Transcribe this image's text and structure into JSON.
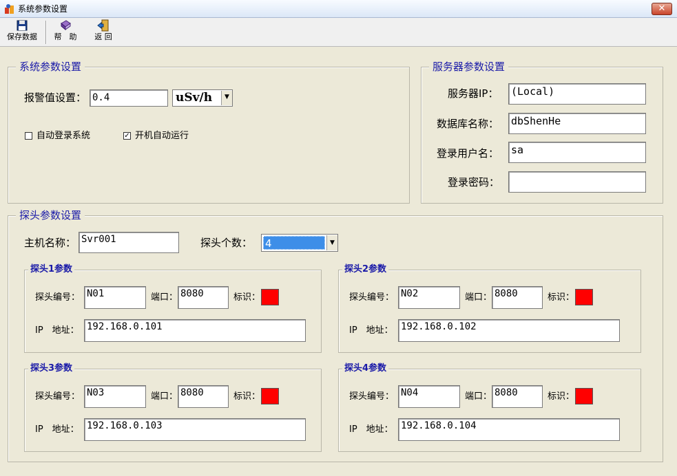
{
  "window": {
    "title": "系统参数设置",
    "close_symbol": "✕"
  },
  "toolbar": {
    "save_label": "保存数据",
    "help_label": "帮　助",
    "back_label": "返 回"
  },
  "system_group": {
    "legend": "系统参数设置",
    "alarm_label": "报警值设置：",
    "alarm_value": "0.4",
    "unit_selected": "uSv/h",
    "auto_login": {
      "label": "自动登录系统",
      "checked": ""
    },
    "auto_start": {
      "label": "开机自动运行",
      "checked": "✓"
    }
  },
  "server_group": {
    "legend": "服务器参数设置",
    "server_ip_label": "服务器IP：",
    "server_ip_value": "(Local)",
    "db_name_label": "数据库名称：",
    "db_name_value": "dbShenHe",
    "user_label": "登录用户名：",
    "user_value": "sa",
    "password_label": "登录密码：",
    "password_value": ""
  },
  "probe_group": {
    "legend": "探头参数设置",
    "host_label": "主机名称：",
    "host_value": "Svr001",
    "count_label": "探头个数：",
    "count_value": "4",
    "probes": [
      {
        "legend": "探头1参数",
        "id_label": "探头编号：",
        "id_value": "N01",
        "port_label": "端口：",
        "port_value": "8080",
        "mark_label": "标识：",
        "mark_color": "#ff0000",
        "ip_label": "IP　地址：",
        "ip_value": "192.168.0.101"
      },
      {
        "legend": "探头2参数",
        "id_label": "探头编号：",
        "id_value": "N02",
        "port_label": "端口：",
        "port_value": "8080",
        "mark_label": "标识：",
        "mark_color": "#ff0000",
        "ip_label": "IP　地址：",
        "ip_value": "192.168.0.102"
      },
      {
        "legend": "探头3参数",
        "id_label": "探头编号：",
        "id_value": "N03",
        "port_label": "端口：",
        "port_value": "8080",
        "mark_label": "标识：",
        "mark_color": "#ff0000",
        "ip_label": "IP　地址：",
        "ip_value": "192.168.0.103"
      },
      {
        "legend": "探头4参数",
        "id_label": "探头编号：",
        "id_value": "N04",
        "port_label": "端口：",
        "port_value": "8080",
        "mark_label": "标识：",
        "mark_color": "#ff0000",
        "ip_label": "IP　地址：",
        "ip_value": "192.168.0.104"
      }
    ]
  },
  "colors": {
    "legend_text": "#1a1aa8",
    "window_bg": "#ece9d8",
    "selection": "#3d8ee8"
  },
  "icons": {
    "app": "app-icon",
    "save": "floppy-disk-icon",
    "help": "help-book-icon",
    "back": "exit-door-icon",
    "combo": "chevron-down-icon"
  }
}
